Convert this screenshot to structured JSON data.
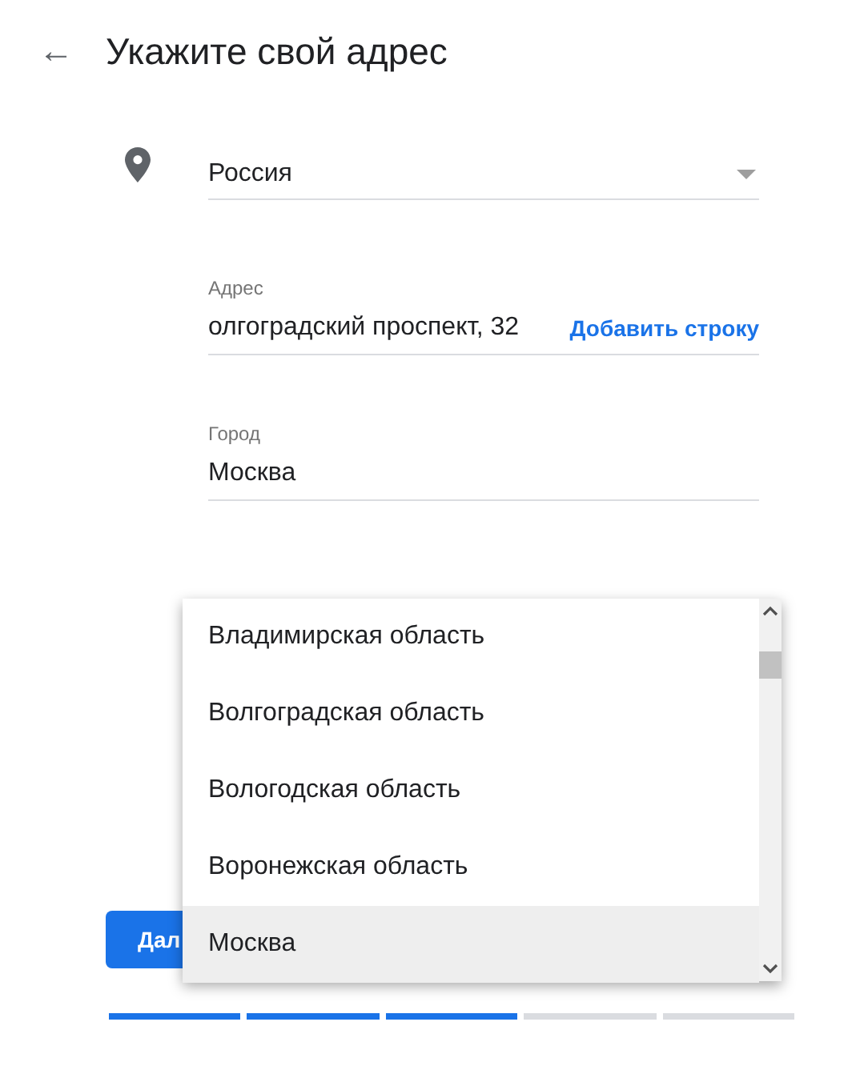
{
  "header": {
    "back": "←",
    "title": "Укажите свой адрес"
  },
  "country": {
    "value": "Россия"
  },
  "fields": [
    {
      "label": "Адрес",
      "value": "олгоградский проспект, 32",
      "action": "Добавить строку"
    },
    {
      "label": "Город",
      "value": "Москва"
    }
  ],
  "next_button": "Дал",
  "dropdown": {
    "options": [
      {
        "label": "Владимирская область",
        "selected": false
      },
      {
        "label": "Волгоградская область",
        "selected": false
      },
      {
        "label": "Вологодская область",
        "selected": false
      },
      {
        "label": "Воронежская область",
        "selected": false
      },
      {
        "label": "Москва",
        "selected": true
      }
    ]
  },
  "progress": [
    {
      "done": true
    },
    {
      "done": true
    },
    {
      "done": true
    },
    {
      "done": false
    },
    {
      "done": false
    }
  ]
}
